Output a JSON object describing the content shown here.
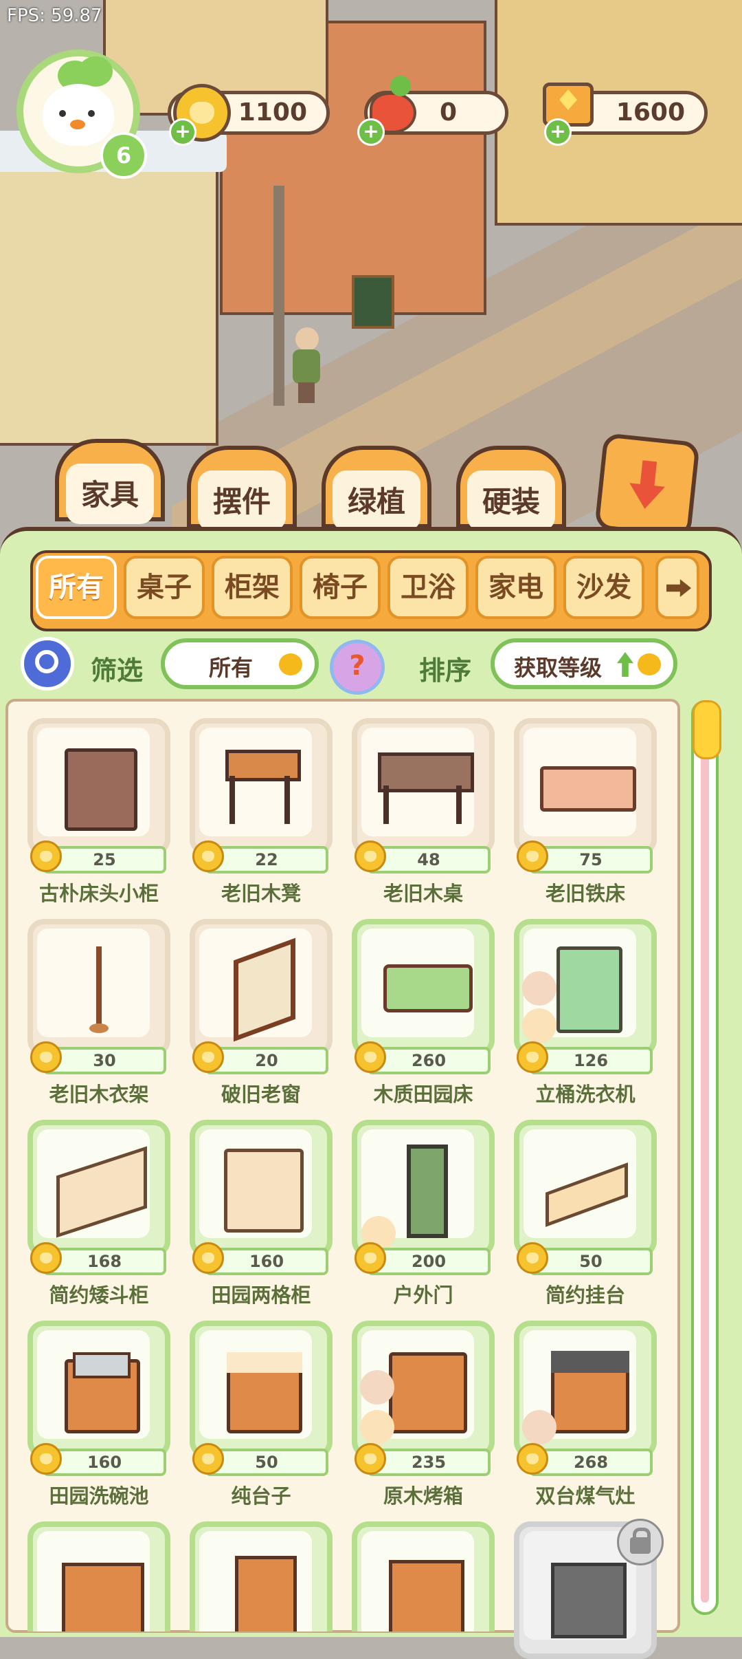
{
  "hud": {
    "fps": "FPS: 59.87",
    "level": "6",
    "resources": [
      {
        "icon": "coin-heart-icon",
        "value": "1100"
      },
      {
        "icon": "carrot-icon",
        "value": "0"
      },
      {
        "icon": "ticket-cart-icon",
        "value": "1600"
      }
    ]
  },
  "tabs": [
    {
      "label": "家具",
      "active": true
    },
    {
      "label": "摆件",
      "active": false
    },
    {
      "label": "绿植",
      "active": false
    },
    {
      "label": "硬装",
      "active": false
    }
  ],
  "categories": [
    {
      "label": "所有",
      "active": true
    },
    {
      "label": "桌子"
    },
    {
      "label": "柜架"
    },
    {
      "label": "椅子"
    },
    {
      "label": "卫浴"
    },
    {
      "label": "家电"
    },
    {
      "label": "沙发"
    }
  ],
  "filter": {
    "filter_label": "筛选",
    "filter_value": "所有",
    "help": "?",
    "sort_label": "排序",
    "sort_value": "获取等级"
  },
  "items": [
    {
      "name": "古朴床头小柜",
      "price": "25",
      "frame": "beige",
      "icon": "nightstand-icon"
    },
    {
      "name": "老旧木凳",
      "price": "22",
      "frame": "beige",
      "icon": "stool-icon"
    },
    {
      "name": "老旧木桌",
      "price": "48",
      "frame": "beige",
      "icon": "desk-icon"
    },
    {
      "name": "老旧铁床",
      "price": "75",
      "frame": "beige",
      "icon": "iron-bed-icon"
    },
    {
      "name": "老旧木衣架",
      "price": "30",
      "frame": "beige",
      "icon": "coat-rack-icon"
    },
    {
      "name": "破旧老窗",
      "price": "20",
      "frame": "beige",
      "icon": "window-icon"
    },
    {
      "name": "木质田园床",
      "price": "260",
      "frame": "green",
      "icon": "green-bed-icon"
    },
    {
      "name": "立桶洗衣机",
      "price": "126",
      "frame": "green",
      "icon": "washing-machine-icon"
    },
    {
      "name": "简约矮斗柜",
      "price": "168",
      "frame": "green",
      "icon": "low-cabinet-icon"
    },
    {
      "name": "田园两格柜",
      "price": "160",
      "frame": "green",
      "icon": "two-door-cabinet-icon"
    },
    {
      "name": "户外门",
      "price": "200",
      "frame": "green",
      "icon": "door-icon"
    },
    {
      "name": "简约挂台",
      "price": "50",
      "frame": "green",
      "icon": "wall-shelf-icon"
    },
    {
      "name": "田园洗碗池",
      "price": "160",
      "frame": "green",
      "icon": "sink-icon"
    },
    {
      "name": "纯台子",
      "price": "50",
      "frame": "green",
      "icon": "counter-icon"
    },
    {
      "name": "原木烤箱",
      "price": "235",
      "frame": "green",
      "icon": "oven-icon"
    },
    {
      "name": "双台煤气灶",
      "price": "268",
      "frame": "green",
      "icon": "stove-icon"
    }
  ]
}
